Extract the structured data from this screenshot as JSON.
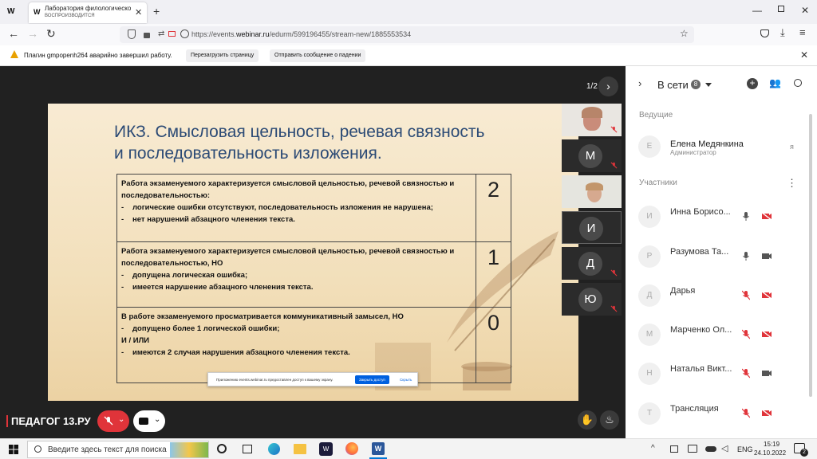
{
  "browser": {
    "tab_title": "Лаборатория филологического",
    "tab_subtitle": "ВОСПРОИЗВОДИТСЯ",
    "url_prefix": "https://events.",
    "url_domain": "webinar.ru",
    "url_path": "/edurm/599196455/stream-new/1885553534"
  },
  "notification": {
    "text": "Плагин gmpopenh264 аварийно завершил работу.",
    "reload_label": "Перезагрузить страницу",
    "report_label": "Отправить сообщение о падении"
  },
  "slide": {
    "counter": "1/2",
    "title_line1": "ИКЗ. Смысловая цельность, речевая связность",
    "title_line2": "и последовательность изложения.",
    "rows": [
      {
        "intro": "Работа экзаменуемого характеризуется смысловой цельностью, речевой связностью и последовательностью:",
        "items": [
          {
            "marker": "-",
            "text": "логические ошибки отсутствуют, последовательность изложения не нарушена;"
          },
          {
            "marker": "-",
            "text": "нет нарушений абзацного членения текста."
          }
        ],
        "score": "2"
      },
      {
        "intro": "Работа экзаменуемого характеризуется смысловой цельностью, речевой связностью и последовательностью, НО",
        "items": [
          {
            "marker": "-",
            "text": "допущена логическая ошибка;"
          },
          {
            "marker": "-",
            "text": "имеется нарушение абзацного членения текста."
          }
        ],
        "score": "1"
      },
      {
        "intro": "В работе экзаменуемого просматривается коммуникативный замысел, НО",
        "items": [
          {
            "marker": "-",
            "text": "допущено более 1 логической ошибки;"
          },
          {
            "marker": "",
            "text": "И / ИЛИ"
          },
          {
            "marker": "-",
            "text": "имеются 2 случая нарушения абзацного членения текста."
          }
        ],
        "score": "0"
      }
    ],
    "permission_text": "Приложению events.webinar.ru предоставлен доступ к вашему экрану.",
    "permission_stop": "Закрыть доступ",
    "permission_hide": "Скрыть"
  },
  "video_tiles": [
    {
      "type": "photo",
      "letter": ""
    },
    {
      "type": "avatar",
      "letter": "М"
    },
    {
      "type": "photo",
      "letter": ""
    },
    {
      "type": "avatar",
      "letter": "И"
    },
    {
      "type": "avatar",
      "letter": "Д"
    },
    {
      "type": "avatar",
      "letter": "Ю"
    }
  ],
  "brand": "ПЕДАГОГ 13.РУ",
  "panel": {
    "header": "В сети",
    "online_count": "8",
    "hosts_label": "Ведущие",
    "host": {
      "initial": "Е",
      "name": "Елена Медянкина",
      "role": "Администратор",
      "me": "я"
    },
    "participants_label": "Участники",
    "participants": [
      {
        "initial": "И",
        "name": "Инна Борисо...",
        "mic": "on",
        "cam": "off"
      },
      {
        "initial": "Р",
        "name": "Разумова Та...",
        "mic": "on",
        "cam": "on"
      },
      {
        "initial": "Д",
        "name": "Дарья",
        "mic": "off",
        "cam": "off"
      },
      {
        "initial": "М",
        "name": "Марченко Ол...",
        "mic": "off",
        "cam": "off"
      },
      {
        "initial": "Н",
        "name": "Наталья Викт...",
        "mic": "off",
        "cam": "on"
      },
      {
        "initial": "Т",
        "name": "Трансляция",
        "mic": "off",
        "cam": "off"
      }
    ]
  },
  "taskbar": {
    "search_placeholder": "Введите здесь текст для поиска",
    "lang": "ENG",
    "time": "15:19",
    "date": "24.10.2022",
    "notif_count": "2"
  },
  "colors": {
    "accent_red": "#e0343a",
    "slide_title": "#2b4a75",
    "firefox_blue": "#0060df"
  }
}
